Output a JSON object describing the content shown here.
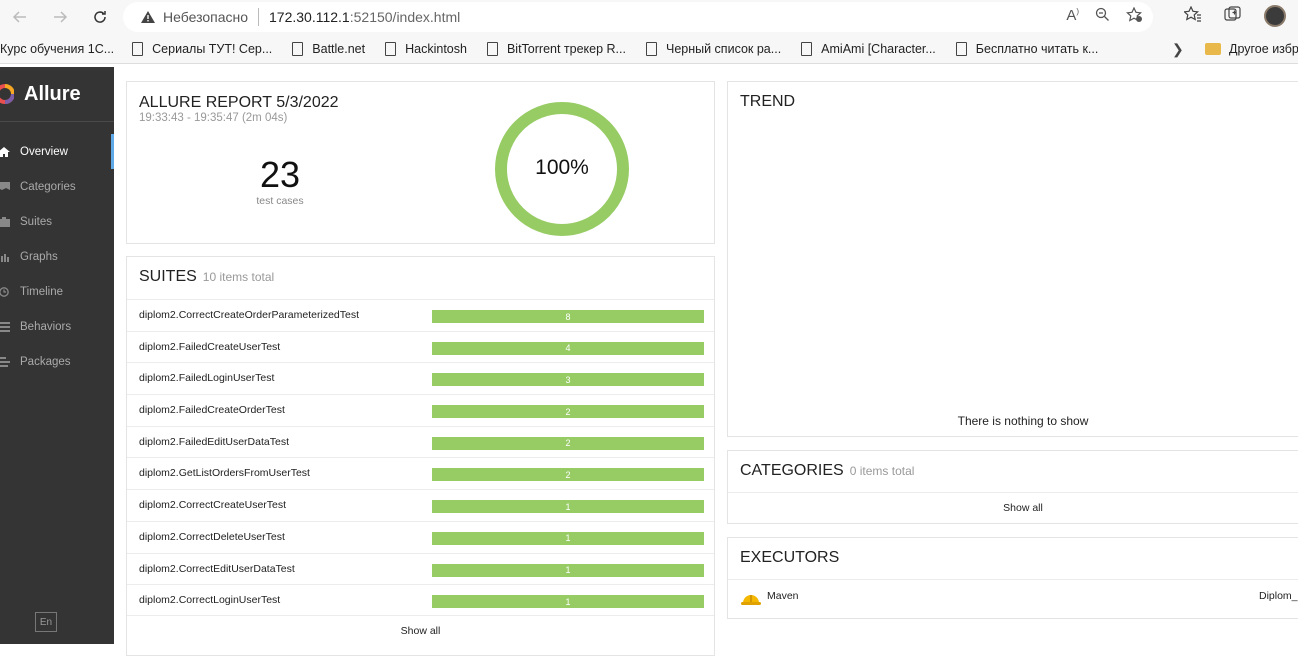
{
  "browser": {
    "insecure_label": "Небезопасно",
    "url_host": "172.30.112.1",
    "url_rest": ":52150/index.html",
    "bookmarks": [
      "Курс обучения 1С...",
      "Сериалы ТУТ! Сер...",
      "Battle.net",
      "Hackintosh",
      "BitTorrent трекер R...",
      "Черный список ра...",
      "AmiAmi [Character...",
      "Бесплатно читать к..."
    ],
    "other_bookmarks": "Другое избр"
  },
  "sidebar": {
    "brand": "Allure",
    "items": [
      {
        "label": "Overview",
        "icon": "home-icon"
      },
      {
        "label": "Categories",
        "icon": "flag-icon"
      },
      {
        "label": "Suites",
        "icon": "briefcase-icon"
      },
      {
        "label": "Graphs",
        "icon": "bar-chart-icon"
      },
      {
        "label": "Timeline",
        "icon": "clock-icon"
      },
      {
        "label": "Behaviors",
        "icon": "list-icon"
      },
      {
        "label": "Packages",
        "icon": "align-left-icon"
      }
    ],
    "language": "En"
  },
  "summary": {
    "title": "ALLURE REPORT 5/3/2022",
    "time": "19:33:43 - 19:35:47 (2m 04s)",
    "count": "23",
    "count_label": "test cases",
    "percent": "100%",
    "pass_fraction": 1.0
  },
  "suites": {
    "title": "SUITES",
    "subtitle": "10 items total",
    "rows": [
      {
        "name": "diplom2.CorrectCreateOrderParameterizedTest",
        "count": "8"
      },
      {
        "name": "diplom2.FailedCreateUserTest",
        "count": "4"
      },
      {
        "name": "diplom2.FailedLoginUserTest",
        "count": "3"
      },
      {
        "name": "diplom2.FailedCreateOrderTest",
        "count": "2"
      },
      {
        "name": "diplom2.FailedEditUserDataTest",
        "count": "2"
      },
      {
        "name": "diplom2.GetListOrdersFromUserTest",
        "count": "2"
      },
      {
        "name": "diplom2.CorrectCreateUserTest",
        "count": "1"
      },
      {
        "name": "diplom2.CorrectDeleteUserTest",
        "count": "1"
      },
      {
        "name": "diplom2.CorrectEditUserDataTest",
        "count": "1"
      },
      {
        "name": "diplom2.CorrectLoginUserTest",
        "count": "1"
      }
    ],
    "show_all": "Show all"
  },
  "trend": {
    "title": "TREND",
    "empty": "There is nothing to show"
  },
  "categories": {
    "title": "CATEGORIES",
    "subtitle": "0 items total",
    "show_all": "Show all"
  },
  "executors": {
    "title": "EXECUTORS",
    "name": "Maven",
    "build": "Diplom_"
  },
  "colors": {
    "passed": "#97cc64",
    "sidebar": "#343434",
    "accent": "#5ea9e6"
  }
}
